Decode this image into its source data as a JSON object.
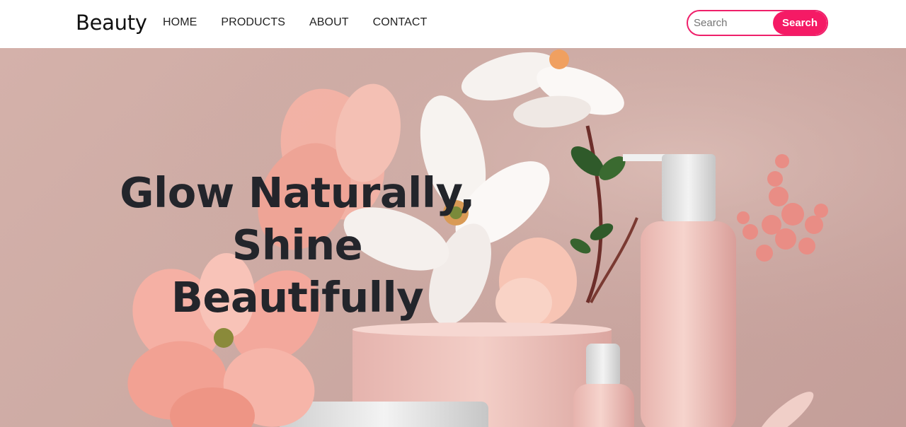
{
  "navbar": {
    "brand": "Beauty",
    "links": [
      {
        "label": "HOME"
      },
      {
        "label": "PRODUCTS"
      },
      {
        "label": "ABOUT"
      },
      {
        "label": "CONTACT"
      }
    ],
    "search": {
      "placeholder": "Search",
      "value": "",
      "button_label": "Search"
    }
  },
  "hero": {
    "title_line1": "Glow Naturally,",
    "title_line2": "Shine Beautifully",
    "image_subject": "pink cosmetic bottles and jars with pink and white flowers"
  },
  "colors": {
    "accent": "#f51a65",
    "hero_background": "#cfaca5",
    "title_text": "#23252b"
  }
}
